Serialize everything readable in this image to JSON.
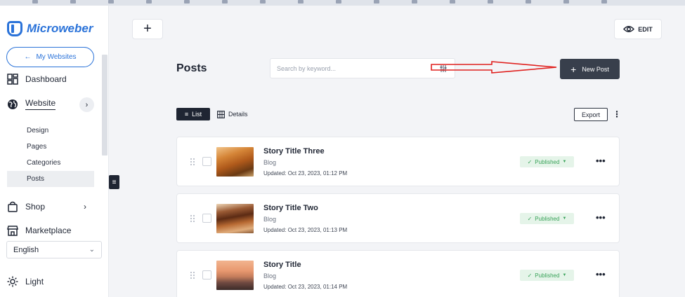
{
  "sidebar": {
    "brand": "Microweber",
    "my_websites": "My Websites",
    "nav": {
      "dashboard": "Dashboard",
      "website": "Website",
      "shop": "Shop",
      "marketplace": "Marketplace",
      "light": "Light"
    },
    "website_sub": {
      "design": "Design",
      "pages": "Pages",
      "categories": "Categories",
      "posts": "Posts"
    },
    "language": "English"
  },
  "header": {
    "edit_label": "EDIT"
  },
  "main": {
    "title": "Posts",
    "search_placeholder": "Search by keyword...",
    "new_post_label": "New Post",
    "view_list_label": "List",
    "view_details_label": "Details",
    "export_label": "Export",
    "posts": [
      {
        "title": "Story Title Three",
        "category": "Blog",
        "updated": "Updated: Oct 23, 2023, 01:12 PM",
        "status": "Published"
      },
      {
        "title": "Story Title Two",
        "category": "Blog",
        "updated": "Updated: Oct 23, 2023, 01:13 PM",
        "status": "Published"
      },
      {
        "title": "Story Title",
        "category": "Blog",
        "updated": "Updated: Oct 23, 2023, 01:14 PM",
        "status": "Published"
      }
    ]
  },
  "colors": {
    "accent": "#2b73d9",
    "dark": "#383f4c",
    "published_bg": "#e5f4e9",
    "published_text": "#3aa35a",
    "annotation": "#e0201e"
  }
}
